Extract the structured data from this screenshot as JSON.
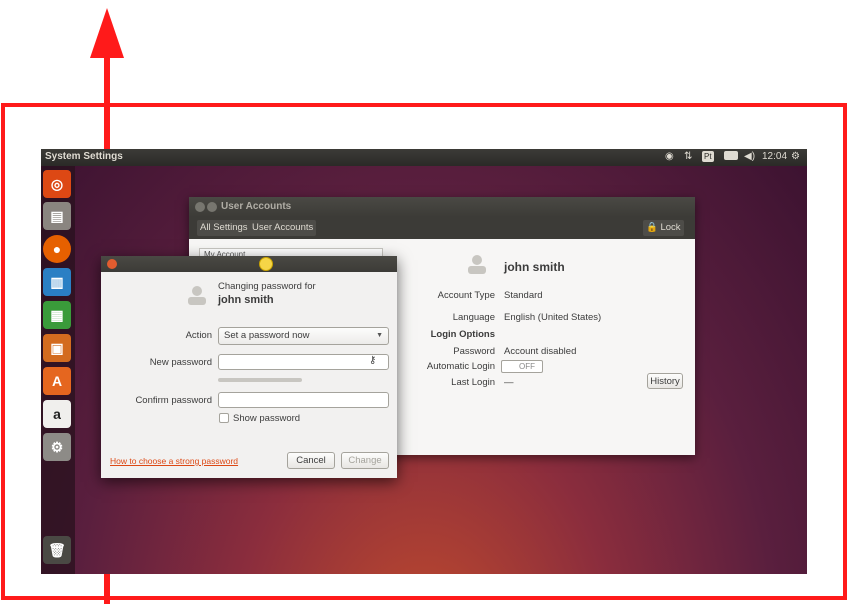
{
  "screen": {
    "topbar_title": "System Settings",
    "tray": {
      "keyboard": "Pt",
      "clock": "12:04"
    }
  },
  "launcher": {
    "items": [
      "ubuntu-dash",
      "files",
      "firefox",
      "libreoffice-writer",
      "libreoffice-calc",
      "libreoffice-impress",
      "software-center",
      "amazon",
      "system-settings",
      "trash"
    ]
  },
  "user_accounts": {
    "window_title": "User Accounts",
    "breadcrumb_all": "All Settings",
    "breadcrumb_current": "User Accounts",
    "lock_label": "Lock",
    "user_list_first": "My Account",
    "username": "john smith",
    "account_type_label": "Account Type",
    "account_type_value": "Standard",
    "language_label": "Language",
    "language_value": "English (United States)",
    "login_options_label": "Login Options",
    "password_label": "Password",
    "password_value": "Account disabled",
    "auto_login_label": "Automatic Login",
    "auto_login_value": "OFF",
    "last_login_label": "Last Login",
    "last_login_value": "—",
    "history_button": "History"
  },
  "password_dialog": {
    "heading": "Changing password for",
    "username": "john smith",
    "action_label": "Action",
    "action_value": "Set a password now",
    "new_password_label": "New password",
    "new_password_value": "",
    "confirm_password_label": "Confirm password",
    "confirm_password_value": "",
    "show_password_label": "Show password",
    "help_link": "How to choose a strong password",
    "cancel_button": "Cancel",
    "change_button": "Change"
  },
  "colors": {
    "annotation_red": "#ff1a1a",
    "link_orange": "#dd4814",
    "desktop_purple": "#5a1f3e"
  }
}
